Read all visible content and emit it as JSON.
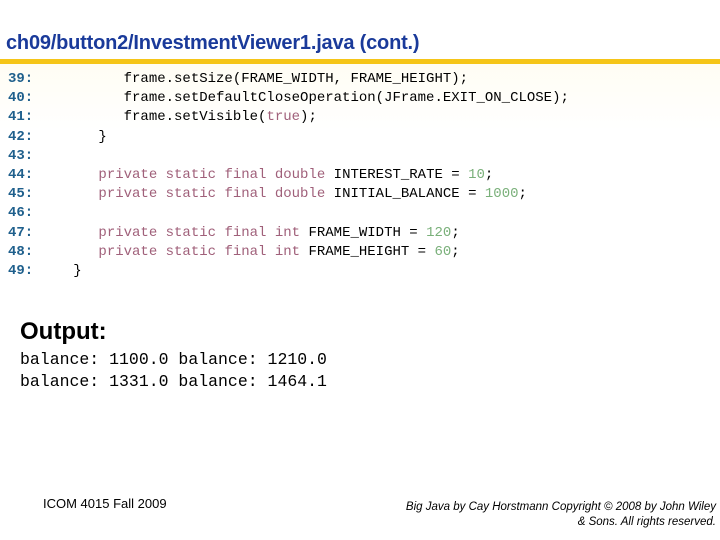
{
  "slide": {
    "title": "ch09/button2/InvestmentViewer1.java  (cont.)",
    "colors": {
      "title": "#1a3a9a",
      "rule": "#f5c518",
      "line_number": "#1e5f8c",
      "keyword": "#a0607a",
      "literal": "#7ab07a"
    }
  },
  "code": {
    "lines": [
      {
        "no": "39:",
        "tokens": [
          {
            "t": "         frame.setSize(FRAME_WIDTH, FRAME_HEIGHT);",
            "k": "plain"
          }
        ]
      },
      {
        "no": "40:",
        "tokens": [
          {
            "t": "         frame.setDefaultCloseOperation(JFrame.EXIT_ON_CLOSE);",
            "k": "plain"
          }
        ]
      },
      {
        "no": "41:",
        "tokens": [
          {
            "t": "         frame.setVisible(",
            "k": "plain"
          },
          {
            "t": "true",
            "k": "kw"
          },
          {
            "t": ");",
            "k": "plain"
          }
        ]
      },
      {
        "no": "42:",
        "tokens": [
          {
            "t": "      }",
            "k": "plain"
          }
        ]
      },
      {
        "no": "43:",
        "tokens": []
      },
      {
        "no": "44:",
        "tokens": [
          {
            "t": "      ",
            "k": "plain"
          },
          {
            "t": "private static final double",
            "k": "kw"
          },
          {
            "t": " INTEREST_RATE = ",
            "k": "plain"
          },
          {
            "t": "10",
            "k": "lit"
          },
          {
            "t": ";",
            "k": "plain"
          }
        ]
      },
      {
        "no": "45:",
        "tokens": [
          {
            "t": "      ",
            "k": "plain"
          },
          {
            "t": "private static final double",
            "k": "kw"
          },
          {
            "t": " INITIAL_BALANCE = ",
            "k": "plain"
          },
          {
            "t": "1000",
            "k": "lit"
          },
          {
            "t": ";",
            "k": "plain"
          }
        ]
      },
      {
        "no": "46:",
        "tokens": []
      },
      {
        "no": "47:",
        "tokens": [
          {
            "t": "      ",
            "k": "plain"
          },
          {
            "t": "private static final int",
            "k": "kw"
          },
          {
            "t": " FRAME_WIDTH = ",
            "k": "plain"
          },
          {
            "t": "120",
            "k": "lit"
          },
          {
            "t": ";",
            "k": "plain"
          }
        ]
      },
      {
        "no": "48:",
        "tokens": [
          {
            "t": "      ",
            "k": "plain"
          },
          {
            "t": "private static final int",
            "k": "kw"
          },
          {
            "t": " FRAME_HEIGHT = ",
            "k": "plain"
          },
          {
            "t": "60",
            "k": "lit"
          },
          {
            "t": ";",
            "k": "plain"
          }
        ]
      },
      {
        "no": "49:",
        "tokens": [
          {
            "t": "   }",
            "k": "plain"
          }
        ]
      }
    ]
  },
  "output": {
    "heading": "Output:",
    "lines": [
      "balance: 1100.0 balance: 1210.0",
      "balance: 1331.0 balance: 1464.1"
    ]
  },
  "footer": {
    "left": "ICOM 4015 Fall 2009",
    "right_line1": "Big Java by Cay Horstmann Copyright © 2008 by John Wiley",
    "right_line2": "& Sons.  All rights reserved."
  }
}
